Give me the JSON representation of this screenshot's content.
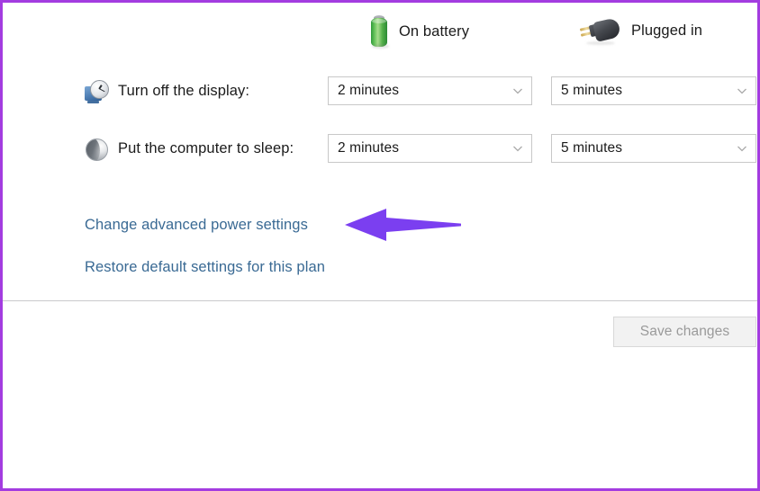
{
  "theme": {
    "border_accent": "#a33ce0",
    "link_color": "#3a6a94",
    "text_color": "#1b1b1b",
    "arrow_color": "#7b3ff0",
    "disabled_text": "#9a9a9a"
  },
  "columns": {
    "battery": {
      "label": "On battery",
      "icon": "battery-icon"
    },
    "plugged": {
      "label": "Plugged in",
      "icon": "power-plug-icon"
    }
  },
  "rows": [
    {
      "id": "display",
      "icon": "display-clock-icon",
      "label": "Turn off the display:",
      "battery_value": "2 minutes",
      "plugged_value": "5 minutes"
    },
    {
      "id": "sleep",
      "icon": "sleep-moon-icon",
      "label": "Put the computer to sleep:",
      "battery_value": "2 minutes",
      "plugged_value": "5 minutes"
    }
  ],
  "links": {
    "advanced": "Change advanced power settings",
    "restore": "Restore default settings for this plan"
  },
  "annotation": {
    "arrow": "left-pointing-arrow",
    "points_at": "Change advanced power settings"
  },
  "footer": {
    "save_label": "Save changes",
    "save_enabled": false
  },
  "icons": {
    "chevron_down": "chevron-down-icon"
  }
}
